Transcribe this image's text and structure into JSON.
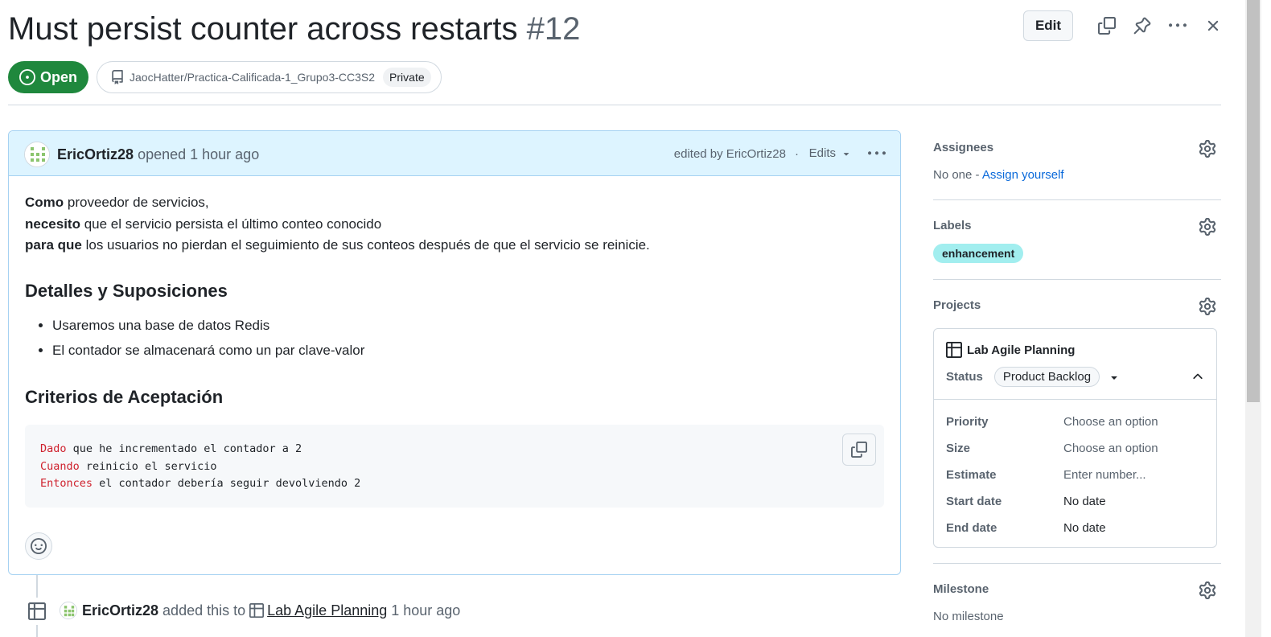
{
  "issue": {
    "title": "Must persist counter across restarts",
    "number": "#12",
    "state": "Open",
    "repo": "JaocHatter/Practica-Calificada-1_Grupo3-CC3S2",
    "visibility": "Private"
  },
  "header_actions": {
    "edit_label": "Edit"
  },
  "comment": {
    "author": "EricOrtiz28",
    "action": "opened 1 hour ago",
    "edited": "edited by EricOrtiz28",
    "edited_sep": "·",
    "edits_label": "Edits",
    "lines": [
      {
        "bold": "Como",
        "text": " proveedor de servicios,"
      },
      {
        "bold": "necesito",
        "text": " que el servicio persista el último conteo conocido"
      },
      {
        "bold": "para que",
        "text": " los usuarios no pierdan el seguimiento de sus conteos después de que el servicio se reinicie."
      }
    ],
    "heading1": "Detalles y Suposiciones",
    "bullets": [
      "Usaremos una base de datos Redis",
      "El contador se almacenará como un par clave-valor"
    ],
    "heading2": "Criterios de Aceptación",
    "code": [
      {
        "kw": "Dado",
        "text": " que he incrementado el contador a 2"
      },
      {
        "kw": "Cuando",
        "text": " reinicio el servicio"
      },
      {
        "kw": "Entonces",
        "text": " el contador debería seguir devolviendo 2"
      }
    ]
  },
  "timeline": {
    "author": "EricOrtiz28",
    "text1": "added this to",
    "project": "Lab Agile Planning",
    "time": "1 hour ago"
  },
  "sidebar": {
    "assignees": {
      "title": "Assignees",
      "value": "No one -",
      "link": "Assign yourself"
    },
    "labels": {
      "title": "Labels",
      "chip": "enhancement"
    },
    "projects": {
      "title": "Projects",
      "project_name": "Lab Agile Planning",
      "status_key": "Status",
      "status_value": "Product Backlog",
      "fields": [
        {
          "key": "Priority",
          "value": "Choose an option"
        },
        {
          "key": "Size",
          "value": "Choose an option"
        },
        {
          "key": "Estimate",
          "value": "Enter number..."
        },
        {
          "key": "Start date",
          "value": "No date"
        },
        {
          "key": "End date",
          "value": "No date"
        }
      ]
    },
    "milestone": {
      "title": "Milestone",
      "value": "No milestone"
    }
  },
  "colors": {
    "open_green": "#1f883d",
    "label_bg": "#a2eeef",
    "link_blue": "#0969da",
    "header_blue": "#ddf4ff",
    "keyword_red": "#cf222e"
  }
}
